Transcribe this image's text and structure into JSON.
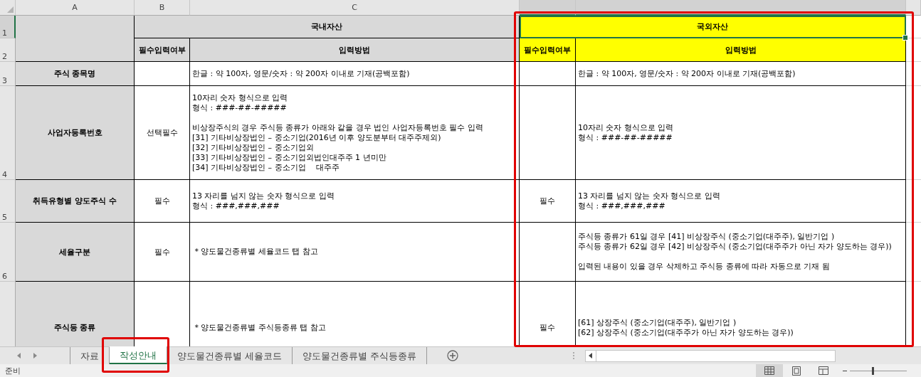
{
  "columns": [
    "A",
    "B",
    "C"
  ],
  "row_numbers": [
    "1",
    "2",
    "3",
    "4",
    "5",
    "6"
  ],
  "domestic": {
    "title": "국내자산",
    "required_header": "필수입력여부",
    "method_header": "입력방법"
  },
  "foreign": {
    "title": "국외자산",
    "required_header": "필수입력여부",
    "method_header": "입력방법",
    "selected": true,
    "highlighted": true
  },
  "rows": [
    {
      "item": "주식 종목명",
      "domestic_method": [
        [
          "한글 : 약 100자, 영문/숫자 : 약 200자 이내로 기재(공백포함)"
        ]
      ],
      "foreign_method": [
        [
          "한글 : 약 100자, 영문/숫자 : 약 200자 이내로 기재(공백포함)"
        ]
      ]
    },
    {
      "item": "사업자등록번호",
      "domestic_required": "선택필수",
      "domestic_method": [
        [
          "10자리 숫자 형식으로 입력",
          "형식 : ###-##-#####"
        ],
        [
          "비상장주식의 경우 주식등 종류가 아래와 같을 경우 법인 사업자등록번호 필수 입력",
          "[31] 기타비상장법인 – 중소기업(2016년 이후 양도분부터 대주주제외)",
          "[32] 기타비상장법인 – 중소기업외",
          "[33] 기타비상장법인 – 중소기업외법인대주주 1 년미만",
          "[34] 기타비상장법인 – 중소기업    대주주"
        ]
      ],
      "foreign_method": [
        [
          "10자리 숫자 형식으로 입력",
          "형식 : ###-##-#####"
        ]
      ]
    },
    {
      "item": "취득유형별 양도주식 수",
      "domestic_required": "필수",
      "domestic_method": [
        [
          "13 자리를 넘지 않는 숫자 형식으로 입력",
          "형식 : ###,###,###"
        ]
      ],
      "foreign_required": "필수",
      "foreign_method": [
        [
          "13 자리를 넘지 않는 숫자 형식으로 입력",
          "형식 : ###,###,###"
        ]
      ]
    },
    {
      "item": "세율구분",
      "domestic_required": "필수",
      "domestic_method": [
        [
          " * 양도물건종류별 세율코드 탭 참고"
        ]
      ],
      "foreign_method": [
        [
          "주식등 종류가 61일 경우 [41] 비상장주식 (중소기업(대주주), 일반기업 )",
          "주식등 종류가 62일 경우 [42] 비상장주식 (중소기업(대주주가 아닌 자가 양도하는 경우))"
        ],
        [
          "입력된 내용이 있을 경우 삭제하고 주식등 종류에 따라 자동으로 기재 됨"
        ]
      ]
    },
    {
      "item": "주식등 종류",
      "domestic_method": [
        [
          " * 양도물건종류별 주식등종류 탭 참고"
        ]
      ],
      "foreign_required": "필수",
      "foreign_method": [
        [
          "[61] 상장주식 (중소기업(대주주), 일반기업 )",
          "[62] 상장주식 (중소기업(대주주가 아닌 자가 양도하는 경우))"
        ]
      ]
    }
  ],
  "tabs": [
    {
      "label": "자료",
      "selected": false,
      "highlighted": false
    },
    {
      "label": "작성안내",
      "selected": true,
      "highlighted": true
    },
    {
      "label": "양도물건종류별 세율코드",
      "selected": false,
      "highlighted": false
    },
    {
      "label": "양도물건종류별 주식등종류",
      "selected": false,
      "highlighted": false
    }
  ],
  "status_bar": {
    "text": "준비"
  },
  "zoom_slider": {
    "level": 0.4
  }
}
